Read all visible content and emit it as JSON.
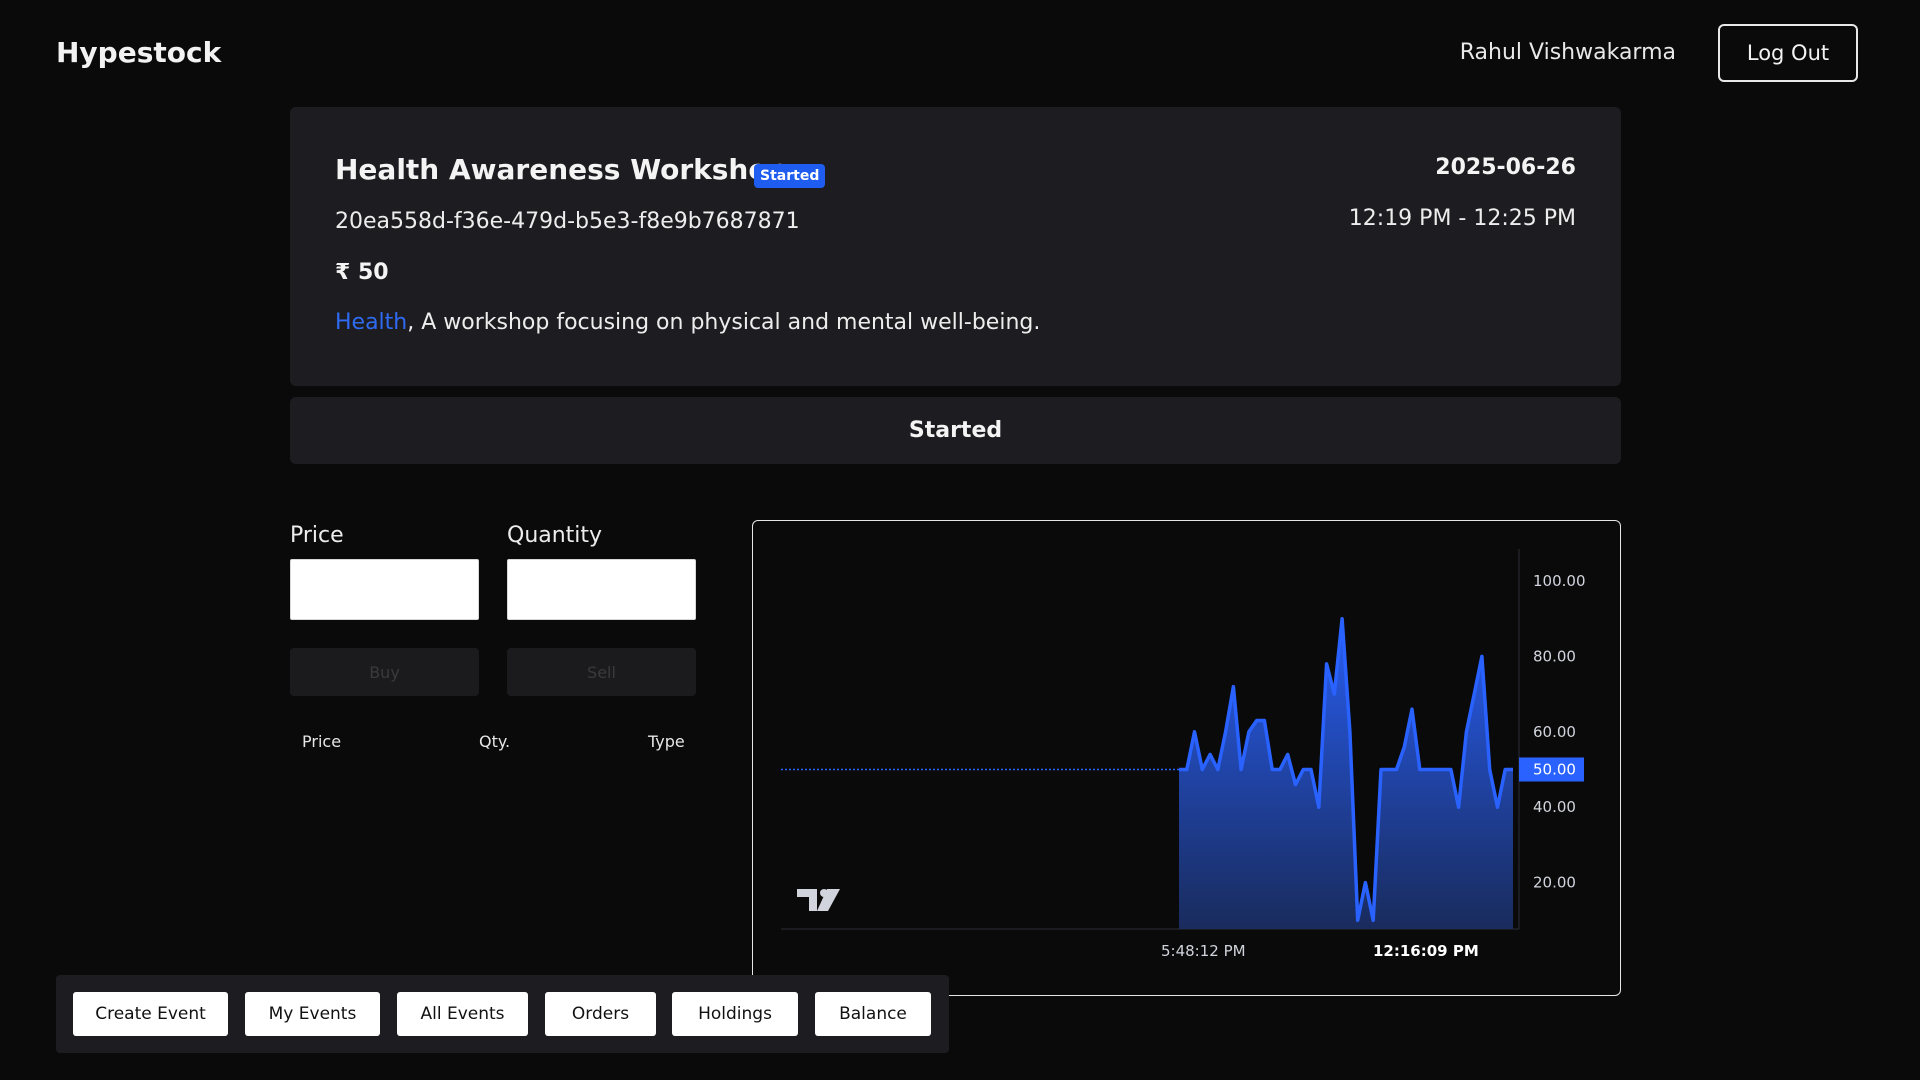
{
  "header": {
    "brand": "Hypestock",
    "user_name": "Rahul Vishwakarma",
    "logout_label": "Log Out"
  },
  "event": {
    "title": "Health Awareness Workshop",
    "status_badge": "Started",
    "date": "2025-06-26",
    "id": "20ea558d-f36e-479d-b5e3-f8e9b7687871",
    "time_range": "12:19 PM - 12:25 PM",
    "price": "₹ 50",
    "category": "Health",
    "description": ", A workshop focusing on physical and mental well-being."
  },
  "status_bar": {
    "label": "Started"
  },
  "order_form": {
    "price_label": "Price",
    "quantity_label": "Quantity",
    "price_value": "",
    "quantity_value": "",
    "buy_label": "Buy",
    "sell_label": "Sell"
  },
  "order_table": {
    "columns": [
      "Price",
      "Qty.",
      "Type"
    ],
    "rows": []
  },
  "chart_data": {
    "type": "area",
    "y_ticks": [
      "100.00",
      "80.00",
      "60.00",
      "40.00",
      "20.00"
    ],
    "ylim": [
      0,
      110
    ],
    "x_tick_labels": [
      "5:48:12 PM",
      "12:16:09 PM"
    ],
    "current_value_label": "50.00",
    "current_value": 50,
    "values": [
      50,
      50,
      60,
      50,
      54,
      50,
      60,
      72,
      50,
      60,
      63,
      63,
      50,
      50,
      54,
      46,
      50,
      50,
      40,
      78,
      70,
      90,
      60,
      10,
      20,
      10,
      50,
      50,
      50,
      56,
      66,
      50,
      50,
      50,
      50,
      50,
      40,
      60,
      70,
      80,
      50,
      40,
      50,
      50
    ],
    "color": "#2962ff",
    "watermark": "TV",
    "xlabel": "",
    "ylabel": "",
    "title": ""
  },
  "bottom_nav": {
    "items": [
      "Create Event",
      "My Events",
      "All Events",
      "Orders",
      "Holdings",
      "Balance"
    ]
  }
}
